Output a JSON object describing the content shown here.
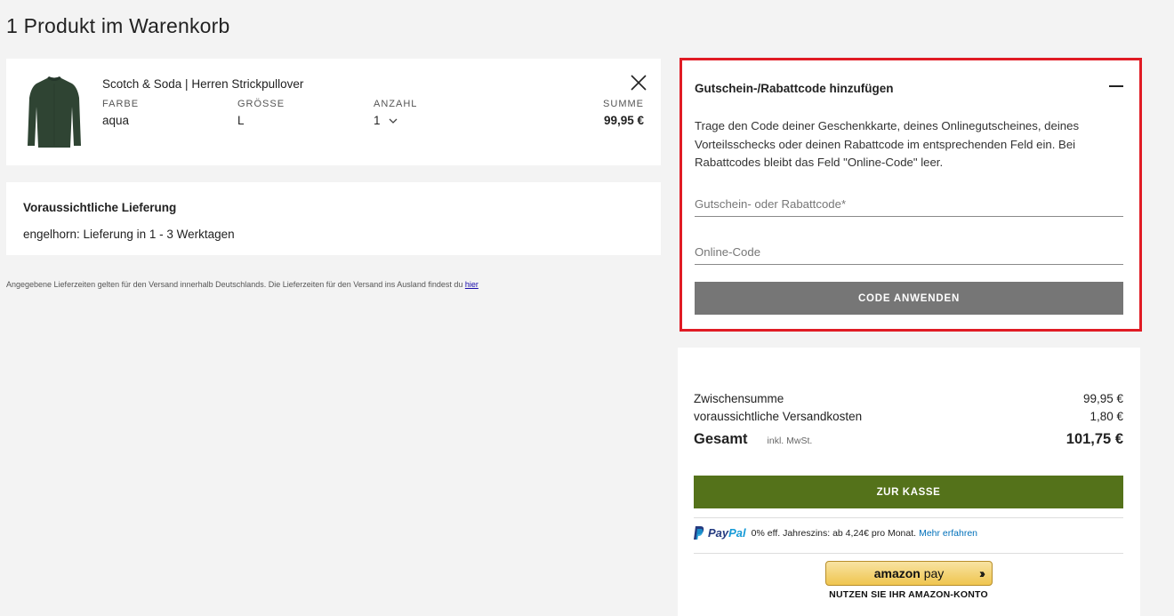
{
  "page": {
    "title": "1 Produkt im Warenkorb"
  },
  "product": {
    "name": "Scotch & Soda | Herren Strickpullover",
    "color_label": "FARBE",
    "color_value": "aqua",
    "size_label": "GRÖSSE",
    "size_value": "L",
    "qty_label": "ANZAHL",
    "qty_value": "1",
    "sum_label": "SUMME",
    "sum_value": "99,95 €",
    "image_color": "#2f4433"
  },
  "delivery": {
    "title": "Voraussichtliche Lieferung",
    "text": "engelhorn: Lieferung in 1 - 3 Werktagen"
  },
  "footnote": {
    "text": "Angegebene Lieferzeiten gelten für den Versand innerhalb Deutschlands. Die Lieferzeiten für den Versand ins Ausland findest du ",
    "link": "hier"
  },
  "voucher": {
    "title": "Gutschein-/Rabattcode hinzufügen",
    "description": "Trage den Code deiner Geschenkkarte, deines Onlinegutscheines, deines Vorteilsschecks oder deinen Rabattcode im entsprechenden Feld ein. Bei Rabattcodes bleibt das Feld \"Online-Code\" leer.",
    "code_placeholder": "Gutschein- oder Rabattcode*",
    "online_placeholder": "Online-Code",
    "apply_label": "CODE ANWENDEN",
    "highlight_color": "#e01b24"
  },
  "summary": {
    "subtotal_label": "Zwischensumme",
    "subtotal_value": "99,95 €",
    "shipping_label": "voraussichtliche Versandkosten",
    "shipping_value": "1,80 €",
    "total_label": "Gesamt",
    "total_tax": "inkl. MwSt.",
    "total_value": "101,75 €",
    "checkout_label": "ZUR KASSE",
    "checkout_color": "#54721a"
  },
  "paypal": {
    "logo_part1": "Pay",
    "logo_part2": "Pal",
    "text": "0% eff. Jahreszins: ab 4,24€ pro Monat.",
    "link": "Mehr erfahren"
  },
  "amazon": {
    "logo_amazon": "amazon",
    "logo_pay": "pay",
    "caption": "NUTZEN SIE IHR AMAZON-KONTO"
  }
}
